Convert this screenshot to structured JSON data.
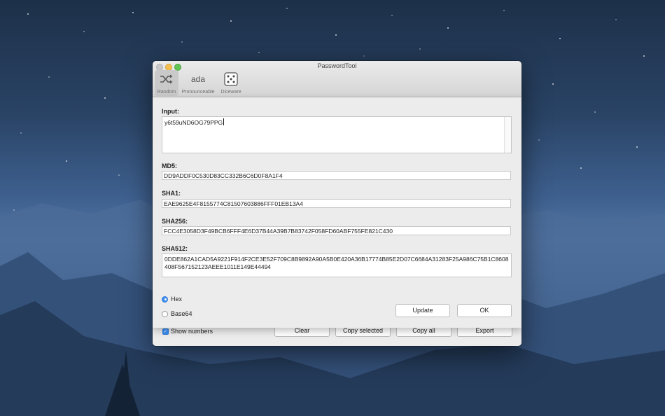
{
  "window": {
    "title": "PasswordTool"
  },
  "toolbar": {
    "items": [
      {
        "label": "Random",
        "icon": "shuffle-icon",
        "active": true
      },
      {
        "label": "Pronounceable",
        "icon": "ada-text-icon",
        "text": "ada",
        "active": false
      },
      {
        "label": "Diceware",
        "icon": "dice-icon",
        "active": false
      }
    ]
  },
  "sheet": {
    "input": {
      "label": "Input:",
      "value": "y6t59uND6OG79PPG"
    },
    "md5": {
      "label": "MD5:",
      "value": "DD9ADDF0C530D83CC332B6C6D0F8A1F4"
    },
    "sha1": {
      "label": "SHA1:",
      "value": "EAE9625E4F8155774C81507603886FFF01EB13A4"
    },
    "sha256": {
      "label": "SHA256:",
      "value": "FCC4E3058D3F49BCB6FFF4E6D37B44A39B7B83742F058FD60ABF755FE821C430"
    },
    "sha512": {
      "label": "SHA512:",
      "value": "0DDE862A1CAD5A9221F914F2CE3E52F709C8B9892A90A5B0E420A36B17774B85E2D07C6684A31283F25A986C75B1C8608408F567152123AEEE1011E149E44494"
    },
    "encoding": {
      "options": [
        {
          "label": "Hex",
          "selected": true
        },
        {
          "label": "Base64",
          "selected": false
        }
      ]
    },
    "buttons": {
      "update": "Update",
      "ok": "OK"
    }
  },
  "bottom": {
    "show_numbers": {
      "label": "Show numbers",
      "checked": true
    },
    "buttons": {
      "clear": "Clear",
      "copy_selected": "Copy selected",
      "copy_all": "Copy all",
      "export": "Export"
    }
  },
  "colors": {
    "accent": "#3b8ff5",
    "window_bg": "#ececec"
  }
}
